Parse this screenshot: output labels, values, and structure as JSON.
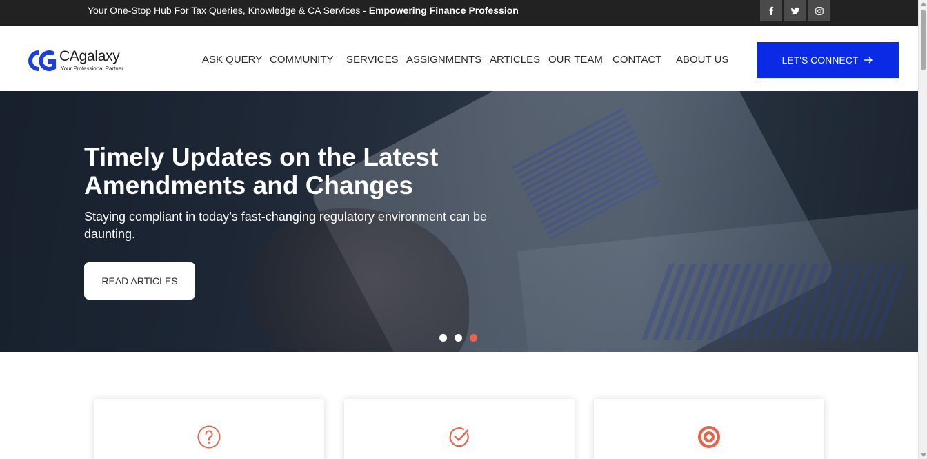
{
  "topbar": {
    "tagline_regular": "Your One-Stop Hub For Tax Queries, Knowledge & CA Services - ",
    "tagline_bold": "Empowering Finance Profession",
    "social": [
      {
        "icon": "facebook-icon"
      },
      {
        "icon": "twitter-icon"
      },
      {
        "icon": "instagram-icon"
      }
    ]
  },
  "header": {
    "logo": {
      "name": "CAgalaxy",
      "tagline": "Your Professional Partner"
    },
    "nav": [
      {
        "label": "ASK QUERY"
      },
      {
        "label": "COMMUNITY"
      },
      {
        "label": "SERVICES"
      },
      {
        "label": "ASSIGNMENTS"
      },
      {
        "label": "ARTICLES"
      },
      {
        "label": "OUR TEAM"
      },
      {
        "label": "CONTACT"
      },
      {
        "label": "ABOUT US"
      }
    ],
    "cta_label": "LET'S CONNECT"
  },
  "hero": {
    "title": "Timely Updates on the Latest Amendments and Changes",
    "subtitle": "Staying compliant in today’s fast-changing regulatory environment can be daunting.",
    "button_label": "READ ARTICLES",
    "slides": 3,
    "active_slide": 3
  },
  "features": [
    {
      "icon": "question-circle-icon"
    },
    {
      "icon": "check-circle-icon"
    },
    {
      "icon": "target-icon"
    }
  ],
  "colors": {
    "accent": "#0a2ae6",
    "icon_accent": "#e5654d",
    "topbar_bg": "#222222"
  }
}
